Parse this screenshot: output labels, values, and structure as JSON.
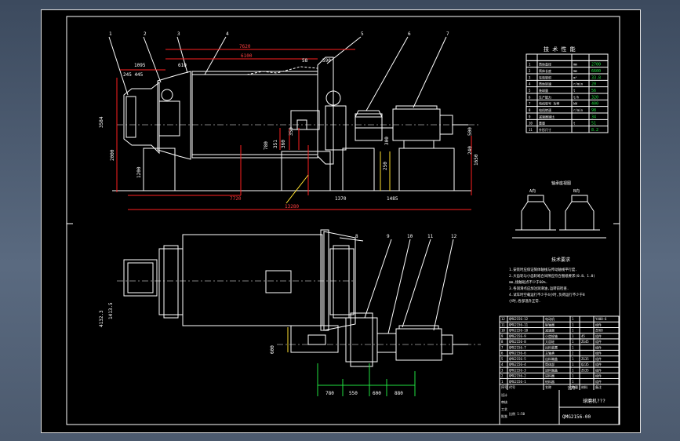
{
  "colors": {
    "background": "#000000",
    "line": "#ffffff",
    "dimension_red": "#ff2020",
    "dimension_green": "#20e040",
    "dimension_yellow": "#ffe030",
    "frame": "#4a5a70"
  },
  "elevation": {
    "callouts": [
      "1",
      "2",
      "3",
      "4",
      "5",
      "6",
      "7"
    ],
    "dims_top": {
      "d7620": "7620",
      "d6100": "6100",
      "d1095": "1095",
      "d245_445": "245 445",
      "d610": "610",
      "d58": "58",
      "d590": "590"
    },
    "dims_left": {
      "d3584": "3584",
      "d2000": "2000",
      "d1200": "1200"
    },
    "dims_middle": {
      "d351": "351",
      "d780": "780",
      "d300": "300",
      "d350": "350",
      "d360": "360",
      "d250": "250",
      "d240": "240",
      "d500": "500",
      "d1650": "1650"
    },
    "dims_bottom": {
      "d7720": "7720",
      "d1370": "1370",
      "d1485": "1485",
      "d13280": "13280"
    }
  },
  "plan": {
    "callouts": [
      "8",
      "9",
      "10",
      "11",
      "12"
    ],
    "dims_left": {
      "d4132": "4132.3",
      "d1413": "1413.5"
    },
    "dims_middle": {
      "d600": "600"
    },
    "dims_bottom": [
      "780",
      "550",
      "600",
      "880"
    ]
  },
  "tech_table": {
    "title": "技 术 性 能",
    "rows": [
      {
        "no": "1",
        "item": "筒体直径",
        "unit": "mm",
        "value": "2700"
      },
      {
        "no": "2",
        "item": "筒体长度",
        "unit": "mm",
        "value": "6600"
      },
      {
        "no": "3",
        "item": "有效容积",
        "unit": "m³",
        "value": "33.8"
      },
      {
        "no": "4",
        "item": "筒体转速",
        "unit": "r/min",
        "value": "20"
      },
      {
        "no": "5",
        "item": "装球量",
        "unit": "t",
        "value": "56"
      },
      {
        "no": "6",
        "item": "生产能力",
        "unit": "t/h",
        "value": "320"
      },
      {
        "no": "7",
        "item": "电机型号 功率",
        "unit": "kW",
        "value": "400"
      },
      {
        "no": "8",
        "item": "电机转速",
        "unit": "r/min",
        "value": "98"
      },
      {
        "no": "9",
        "item": "减速器速比",
        "unit": "",
        "value": "34"
      },
      {
        "no": "10",
        "item": "重量",
        "unit": "t",
        "value": "51"
      },
      {
        "no": "11",
        "item": "外形尺寸",
        "unit": "",
        "value": "8.2"
      }
    ]
  },
  "detail_view": {
    "title": "轴承座视图",
    "left_label": "A向",
    "right_label": "B向"
  },
  "tech_req": {
    "title": "技术要求",
    "lines": [
      "1.安装时应保证筒体轴线与传动轴线平行度.",
      "2.大齿轮与小齿轮啮合间隙应符合图纸要求(0.8、1.0)",
      "  mm,接触斑点不少于60%.",
      "3.各润滑点应加注润滑油,运转前检查.",
      "4.试车时空载运行不少于4小时,负荷运行不少于8",
      "  小时,各部温升正常."
    ]
  },
  "title_block": {
    "parts": [
      {
        "no": "12",
        "code": "QMG2156-12",
        "name": "电动机",
        "qty": "1",
        "mat": "",
        "note": "Y400-6"
      },
      {
        "no": "11",
        "code": "QMG2156-11",
        "name": "联轴器",
        "qty": "1",
        "mat": "",
        "note": "组件"
      },
      {
        "no": "10",
        "code": "QMG2156-10",
        "name": "减速器",
        "qty": "1",
        "mat": "",
        "note": "ZD60"
      },
      {
        "no": "9",
        "code": "QMG2156-9",
        "name": "小齿轮轴",
        "qty": "1",
        "mat": "45",
        "note": "组件"
      },
      {
        "no": "8",
        "code": "QMG2156-8",
        "name": "大齿轮",
        "qty": "1",
        "mat": "ZG45",
        "note": "组件"
      },
      {
        "no": "7",
        "code": "QMG2156-7",
        "name": "出料装置",
        "qty": "1",
        "mat": "",
        "note": "组件"
      },
      {
        "no": "6",
        "code": "QMG2156-6",
        "name": "主轴承",
        "qty": "2",
        "mat": "",
        "note": "组件"
      },
      {
        "no": "5",
        "code": "QMG2156-5",
        "name": "出料端盖",
        "qty": "1",
        "mat": "ZG35",
        "note": "组件"
      },
      {
        "no": "4",
        "code": "QMG2156-4",
        "name": "筒体部",
        "qty": "1",
        "mat": "Q235",
        "note": "组件"
      },
      {
        "no": "3",
        "code": "QMG2156-3",
        "name": "进料端盖",
        "qty": "1",
        "mat": "ZG35",
        "note": "组件"
      },
      {
        "no": "2",
        "code": "QMG2156-2",
        "name": "进料器",
        "qty": "1",
        "mat": "",
        "note": "组件"
      },
      {
        "no": "1",
        "code": "QMG2156-1",
        "name": "给料器",
        "qty": "1",
        "mat": "",
        "note": "组件"
      }
    ],
    "header_row": [
      "序号",
      "代号",
      "名称",
      "数量",
      "材料",
      "备注"
    ],
    "title_text": "???",
    "drawing_name": "球磨机???",
    "drawing_code": "QMG2156-00",
    "scale_label": "比例 1:50",
    "sign_labels": [
      "设计",
      "审核",
      "工艺",
      "批准"
    ]
  }
}
